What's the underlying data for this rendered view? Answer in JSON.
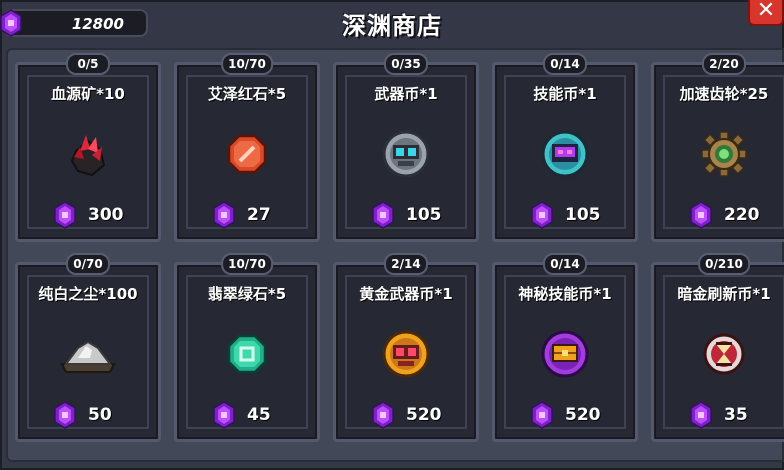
{
  "shop": {
    "title": "深渊商店",
    "currency_amount": "12800",
    "close_label": "✕"
  },
  "items": [
    {
      "stock": "0/5",
      "name": "血源矿*10",
      "price": "300",
      "icon": "blood-ore-icon"
    },
    {
      "stock": "10/70",
      "name": "艾泽红石*5",
      "price": "27",
      "icon": "red-stone-icon"
    },
    {
      "stock": "0/35",
      "name": "武器币*1",
      "price": "105",
      "icon": "weapon-coin-icon"
    },
    {
      "stock": "0/14",
      "name": "技能币*1",
      "price": "105",
      "icon": "skill-coin-icon"
    },
    {
      "stock": "2/20",
      "name": "加速齿轮*25",
      "price": "220",
      "icon": "gear-icon"
    },
    {
      "stock": "0/70",
      "name": "纯白之尘*100",
      "price": "50",
      "icon": "white-dust-icon"
    },
    {
      "stock": "10/70",
      "name": "翡翠绿石*5",
      "price": "45",
      "icon": "green-stone-icon"
    },
    {
      "stock": "2/14",
      "name": "黄金武器币*1",
      "price": "520",
      "icon": "gold-weapon-coin-icon"
    },
    {
      "stock": "0/14",
      "name": "神秘技能币*1",
      "price": "520",
      "icon": "mystic-skill-coin-icon"
    },
    {
      "stock": "0/210",
      "name": "暗金刷新币*1",
      "price": "35",
      "icon": "dark-gold-refresh-coin-icon"
    }
  ],
  "colors": {
    "gem": "#b03cf0",
    "close": "#d8352d"
  }
}
